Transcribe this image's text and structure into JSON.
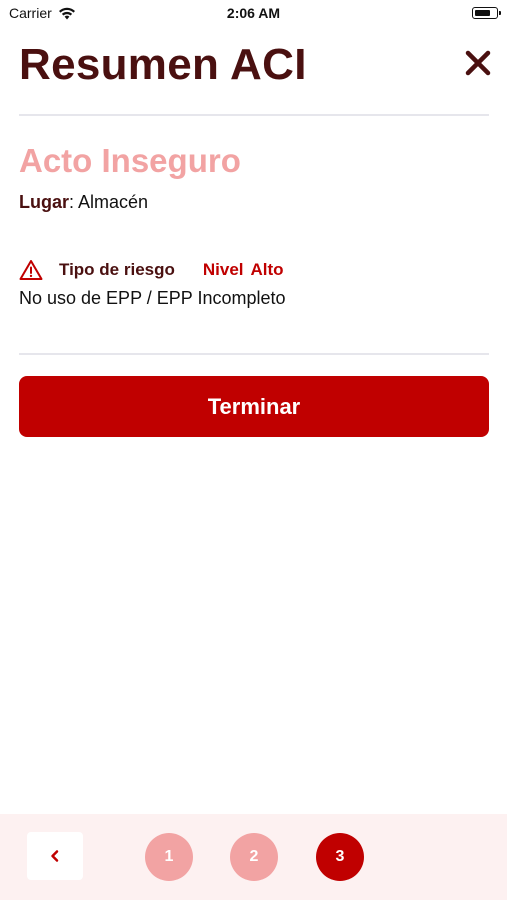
{
  "status_bar": {
    "carrier": "Carrier",
    "time": "2:06 AM",
    "icons": [
      "wifi-icon",
      "battery-icon"
    ]
  },
  "header": {
    "title": "Resumen ACI",
    "close_icon": "close-icon"
  },
  "summary": {
    "section_title": "Acto Inseguro",
    "location_label": "Lugar",
    "location_value": ": Almacén",
    "risk_icon": "warning-icon",
    "risk_type_label": "Tipo de riesgo",
    "risk_level_label": "Nivel",
    "risk_level_value": "Alto",
    "risk_description": "No uso de EPP / EPP Incompleto"
  },
  "actions": {
    "finish_label": "Terminar"
  },
  "stepper": {
    "back_icon": "chevron-left-icon",
    "steps": [
      "1",
      "2",
      "3"
    ],
    "current_step": "3"
  },
  "colors": {
    "title": "#4a1010",
    "accent": "#c00000",
    "accent_light": "#f2a3a3",
    "footer_bg": "#fdf1f1"
  }
}
